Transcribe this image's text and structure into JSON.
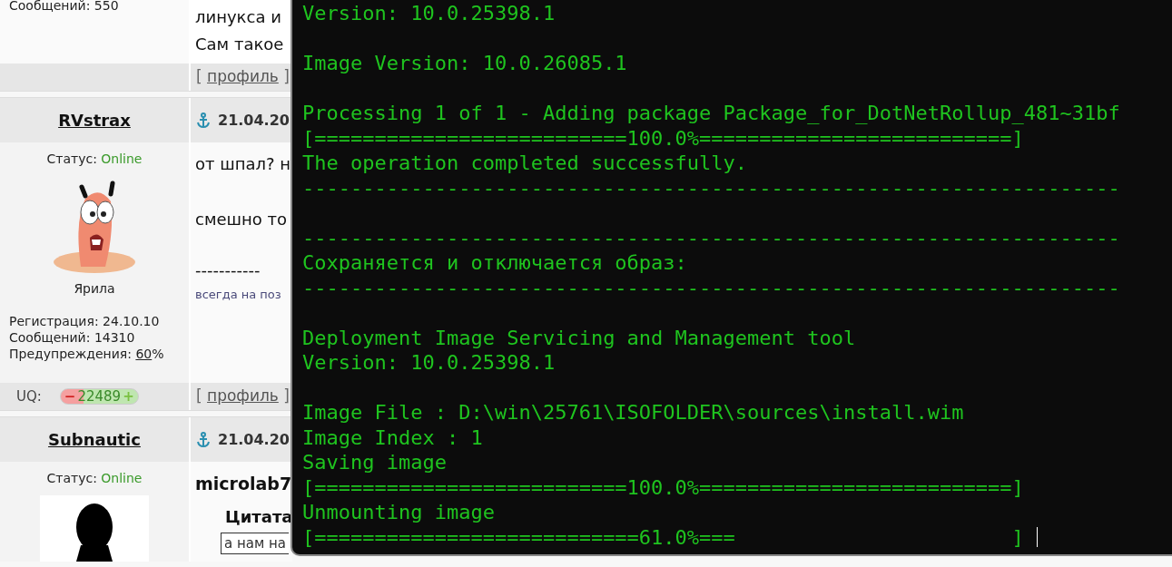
{
  "forum": {
    "first_post_tail": {
      "user_lines": [
        "Сообщений: 550"
      ],
      "body_lines": [
        "линукса и",
        "Сам такое"
      ],
      "footer": {
        "open": "[",
        "link": "профиль",
        "close": "]"
      }
    },
    "posts": [
      {
        "author": "RVstrax",
        "date": "21.04.20",
        "status_label": "Статус:",
        "status": "Online",
        "avatar": {
          "kind": "cartoon"
        },
        "rank": "Ярила",
        "stats": [
          {
            "label": "Регистрация:",
            "value": "24.10.10"
          },
          {
            "label": "Сообщений:",
            "value": "14310"
          }
        ],
        "warnings": {
          "label": "Предупреждения:",
          "value": "60",
          "suffix": "%"
        },
        "body": [
          {
            "kind": "text",
            "text": "от шпал? н"
          },
          {
            "kind": "text",
            "text": "смешно то"
          },
          {
            "kind": "rule",
            "text": "-----------"
          },
          {
            "kind": "signature",
            "text": "всегда на поз"
          }
        ],
        "uq": {
          "label": "UQ:",
          "minus": "−",
          "value": "22489",
          "plus": "+"
        },
        "footer": {
          "open": "[",
          "link": "профиль",
          "close": "]"
        }
      },
      {
        "author": "Subnautic",
        "date": "21.04.20",
        "status_label": "Статус:",
        "status": "Online",
        "avatar": {
          "kind": "silhouette"
        },
        "body": [
          {
            "kind": "heading",
            "text": "microlab7"
          },
          {
            "kind": "quote",
            "title": "Цитата",
            "text": "а нам на"
          }
        ]
      }
    ]
  },
  "terminal": {
    "cursor": true,
    "lines": [
      {
        "kind": "text",
        "text": "Version: 10.0.25398.1"
      },
      {
        "kind": "blank"
      },
      {
        "kind": "text",
        "text": "Image Version: 10.0.26085.1"
      },
      {
        "kind": "blank"
      },
      {
        "kind": "text",
        "text": "Processing 1 of 1 - Adding package Package_for_DotNetRollup_481~31bf"
      },
      {
        "kind": "text",
        "text": "[==========================100.0%==========================]"
      },
      {
        "kind": "text",
        "text": "The operation completed successfully."
      },
      {
        "kind": "text",
        "text": "--------------------------------------------------------------------"
      },
      {
        "kind": "blank"
      },
      {
        "kind": "text",
        "text": "--------------------------------------------------------------------"
      },
      {
        "kind": "text",
        "text": "Сохраняется и отключается образ:"
      },
      {
        "kind": "text",
        "text": "--------------------------------------------------------------------"
      },
      {
        "kind": "blank"
      },
      {
        "kind": "text",
        "text": "Deployment Image Servicing and Management tool"
      },
      {
        "kind": "text",
        "text": "Version: 10.0.25398.1"
      },
      {
        "kind": "blank"
      },
      {
        "kind": "text",
        "text": "Image File : D:\\win\\25761\\ISOFOLDER\\sources\\install.wim"
      },
      {
        "kind": "text",
        "text": "Image Index : 1"
      },
      {
        "kind": "text",
        "text": "Saving image"
      },
      {
        "kind": "text",
        "text": "[==========================100.0%==========================]"
      },
      {
        "kind": "text",
        "text": "Unmounting image"
      },
      {
        "kind": "text",
        "text": "[===========================61.0%===                       ]"
      }
    ]
  }
}
